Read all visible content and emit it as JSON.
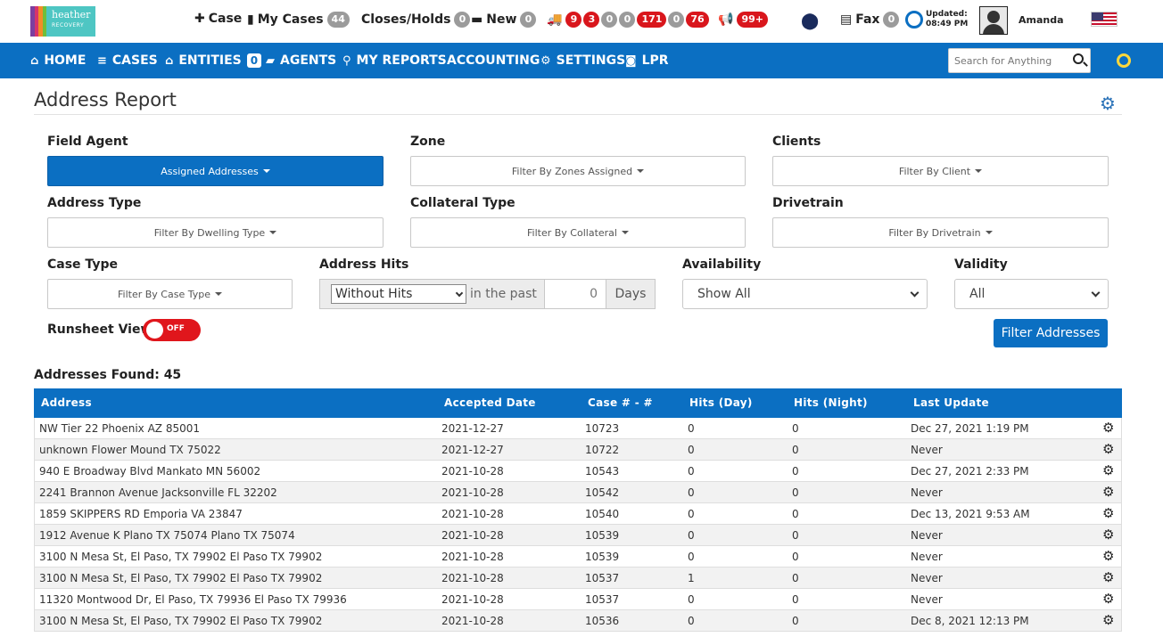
{
  "logo": {
    "line1": "heather",
    "line2": "RECOVERY"
  },
  "topbar": {
    "case_label": "Case",
    "my_cases_label": "My Cases",
    "my_cases_count": "44",
    "closes_holds_label": "Closes/Holds",
    "closes_holds_count": "0",
    "new_label": "New",
    "new_count": "0",
    "truck_badges": [
      "9",
      "3",
      "0",
      "0",
      "171",
      "0",
      "76"
    ],
    "announcements_count": "99+",
    "fax_label": "Fax",
    "fax_count": "0",
    "updated_label": "Updated:",
    "updated_time": "08:49 PM",
    "user_name": "Amanda"
  },
  "nav": {
    "home": "HOME",
    "cases": "CASES",
    "entities": "ENTITIES",
    "entities_count": "0",
    "agents": "AGENTS",
    "my_reports": "MY REPORTS",
    "accounting": "ACCOUNTING",
    "settings": "SETTINGS",
    "lpr": "LPR",
    "search_placeholder": "Search for Anything"
  },
  "page": {
    "title": "Address Report"
  },
  "filters": {
    "field_agent_label": "Field Agent",
    "field_agent_value": "Assigned Addresses",
    "zone_label": "Zone",
    "zone_value": "Filter By Zones Assigned",
    "clients_label": "Clients",
    "clients_value": "Filter By Client",
    "address_type_label": "Address Type",
    "address_type_value": "Filter By Dwelling Type",
    "collateral_type_label": "Collateral Type",
    "collateral_type_value": "Filter By Collateral",
    "drivetrain_label": "Drivetrain",
    "drivetrain_value": "Filter By Drivetrain",
    "case_type_label": "Case Type",
    "case_type_value": "Filter By Case Type",
    "address_hits_label": "Address Hits",
    "address_hits_select": "Without Hits",
    "address_hits_past": "in the past",
    "address_hits_days_value": "0",
    "address_hits_days_label": "Days",
    "availability_label": "Availability",
    "availability_value": "Show All",
    "validity_label": "Validity",
    "validity_value": "All",
    "runsheet_label": "Runsheet View",
    "runsheet_state": "OFF",
    "filter_button": "Filter Addresses"
  },
  "results": {
    "found_label": "Addresses Found: 45"
  },
  "table": {
    "headers": [
      "Address",
      "Accepted Date",
      "Case # - #",
      "Hits (Day)",
      "Hits (Night)",
      "Last Update"
    ],
    "rows": [
      [
        "NW Tier 22 Phoenix AZ 85001",
        "2021-12-27",
        "10723",
        "0",
        "0",
        "Dec 27, 2021 1:19 PM"
      ],
      [
        "unknown Flower Mound TX 75022",
        "2021-12-27",
        "10722",
        "0",
        "0",
        "Never"
      ],
      [
        "940 E Broadway Blvd Mankato MN 56002",
        "2021-10-28",
        "10543",
        "0",
        "0",
        "Dec 27, 2021 2:33 PM"
      ],
      [
        "2241 Brannon Avenue Jacksonville FL 32202",
        "2021-10-28",
        "10542",
        "0",
        "0",
        "Never"
      ],
      [
        "1859 SKIPPERS RD Emporia VA 23847",
        "2021-10-28",
        "10540",
        "0",
        "0",
        "Dec 13, 2021 9:53 AM"
      ],
      [
        "1912 Avenue K Plano TX 75074 Plano TX 75074",
        "2021-10-28",
        "10539",
        "0",
        "0",
        "Never"
      ],
      [
        "3100 N Mesa St, El Paso, TX 79902 El Paso TX 79902",
        "2021-10-28",
        "10539",
        "0",
        "0",
        "Never"
      ],
      [
        "3100 N Mesa St, El Paso, TX 79902 El Paso TX 79902",
        "2021-10-28",
        "10537",
        "1",
        "0",
        "Never"
      ],
      [
        "11320 Montwood Dr, El Paso, TX 79936 El Paso TX 79936",
        "2021-10-28",
        "10537",
        "0",
        "0",
        "Never"
      ],
      [
        "3100 N Mesa St, El Paso, TX 79902 El Paso TX 79902",
        "2021-10-28",
        "10536",
        "0",
        "0",
        "Dec 8, 2021 12:13 PM"
      ]
    ]
  }
}
